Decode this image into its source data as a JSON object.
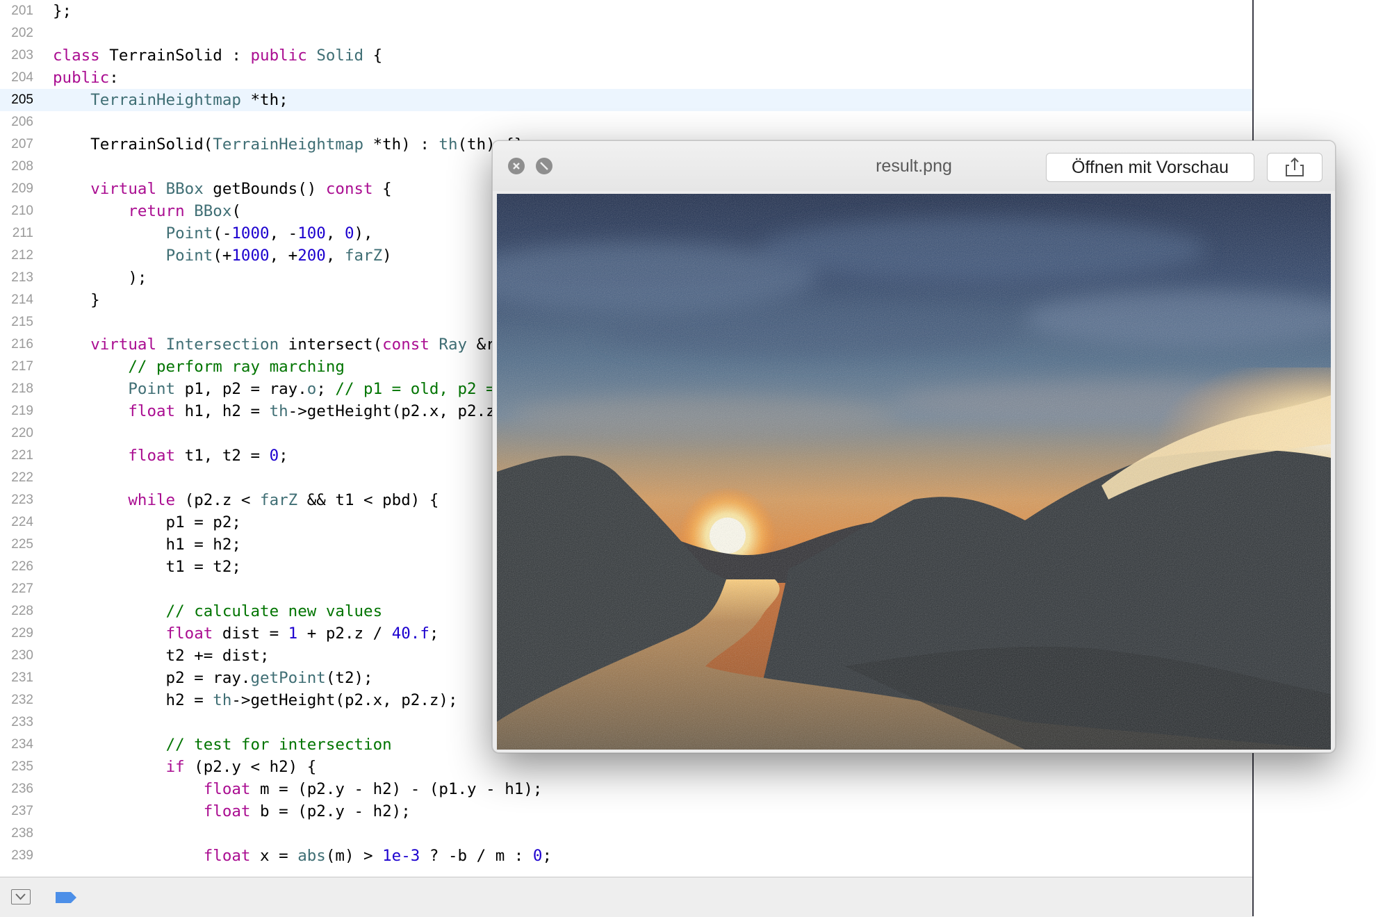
{
  "editor": {
    "current_line": 205,
    "lines": [
      {
        "no": "201",
        "segs": [
          {
            "c": "pl",
            "t": "};"
          }
        ]
      },
      {
        "no": "202",
        "segs": []
      },
      {
        "no": "203",
        "segs": [
          {
            "c": "kw",
            "t": "class"
          },
          {
            "c": "pl",
            "t": " TerrainSolid : "
          },
          {
            "c": "kw",
            "t": "public"
          },
          {
            "c": "pl",
            "t": " "
          },
          {
            "c": "typ",
            "t": "Solid"
          },
          {
            "c": "pl",
            "t": " {"
          }
        ]
      },
      {
        "no": "204",
        "segs": [
          {
            "c": "kw",
            "t": "public"
          },
          {
            "c": "pl",
            "t": ":"
          }
        ]
      },
      {
        "no": "205",
        "segs": [
          {
            "c": "pl",
            "t": "    "
          },
          {
            "c": "typ",
            "t": "TerrainHeightmap"
          },
          {
            "c": "pl",
            "t": " *th;"
          }
        ]
      },
      {
        "no": "206",
        "segs": []
      },
      {
        "no": "207",
        "segs": [
          {
            "c": "pl",
            "t": "    TerrainSolid("
          },
          {
            "c": "typ",
            "t": "TerrainHeightmap"
          },
          {
            "c": "pl",
            "t": " *th) : "
          },
          {
            "c": "typ",
            "t": "th"
          },
          {
            "c": "pl",
            "t": "(th) {}"
          }
        ]
      },
      {
        "no": "208",
        "segs": []
      },
      {
        "no": "209",
        "segs": [
          {
            "c": "pl",
            "t": "    "
          },
          {
            "c": "kw",
            "t": "virtual"
          },
          {
            "c": "pl",
            "t": " "
          },
          {
            "c": "typ",
            "t": "BBox"
          },
          {
            "c": "pl",
            "t": " getBounds() "
          },
          {
            "c": "kw",
            "t": "const"
          },
          {
            "c": "pl",
            "t": " {"
          }
        ]
      },
      {
        "no": "210",
        "segs": [
          {
            "c": "pl",
            "t": "        "
          },
          {
            "c": "kw",
            "t": "return"
          },
          {
            "c": "pl",
            "t": " "
          },
          {
            "c": "typ",
            "t": "BBox"
          },
          {
            "c": "pl",
            "t": "("
          }
        ]
      },
      {
        "no": "211",
        "segs": [
          {
            "c": "pl",
            "t": "            "
          },
          {
            "c": "typ",
            "t": "Point"
          },
          {
            "c": "pl",
            "t": "(-"
          },
          {
            "c": "num",
            "t": "1000"
          },
          {
            "c": "pl",
            "t": ", -"
          },
          {
            "c": "num",
            "t": "100"
          },
          {
            "c": "pl",
            "t": ", "
          },
          {
            "c": "num",
            "t": "0"
          },
          {
            "c": "pl",
            "t": "),"
          }
        ]
      },
      {
        "no": "212",
        "segs": [
          {
            "c": "pl",
            "t": "            "
          },
          {
            "c": "typ",
            "t": "Point"
          },
          {
            "c": "pl",
            "t": "(+"
          },
          {
            "c": "num",
            "t": "1000"
          },
          {
            "c": "pl",
            "t": ", +"
          },
          {
            "c": "num",
            "t": "200"
          },
          {
            "c": "pl",
            "t": ", "
          },
          {
            "c": "typ",
            "t": "farZ"
          },
          {
            "c": "pl",
            "t": ")"
          }
        ]
      },
      {
        "no": "213",
        "segs": [
          {
            "c": "pl",
            "t": "        );"
          }
        ]
      },
      {
        "no": "214",
        "segs": [
          {
            "c": "pl",
            "t": "    }"
          }
        ]
      },
      {
        "no": "215",
        "segs": []
      },
      {
        "no": "216",
        "segs": [
          {
            "c": "pl",
            "t": "    "
          },
          {
            "c": "kw",
            "t": "virtual"
          },
          {
            "c": "pl",
            "t": " "
          },
          {
            "c": "typ",
            "t": "Intersection"
          },
          {
            "c": "pl",
            "t": " intersect("
          },
          {
            "c": "kw",
            "t": "const"
          },
          {
            "c": "pl",
            "t": " "
          },
          {
            "c": "typ",
            "t": "Ray"
          },
          {
            "c": "pl",
            "t": " &r"
          }
        ]
      },
      {
        "no": "217",
        "segs": [
          {
            "c": "pl",
            "t": "        "
          },
          {
            "c": "cmt",
            "t": "// perform ray marching"
          }
        ]
      },
      {
        "no": "218",
        "segs": [
          {
            "c": "pl",
            "t": "        "
          },
          {
            "c": "typ",
            "t": "Point"
          },
          {
            "c": "pl",
            "t": " p1, p2 = ray."
          },
          {
            "c": "typ",
            "t": "o"
          },
          {
            "c": "pl",
            "t": "; "
          },
          {
            "c": "cmt",
            "t": "// p1 = old, p2 ="
          }
        ]
      },
      {
        "no": "219",
        "segs": [
          {
            "c": "pl",
            "t": "        "
          },
          {
            "c": "kw",
            "t": "float"
          },
          {
            "c": "pl",
            "t": " h1, h2 = "
          },
          {
            "c": "typ",
            "t": "th"
          },
          {
            "c": "pl",
            "t": "->getHeight(p2.x, p2.z"
          }
        ]
      },
      {
        "no": "220",
        "segs": []
      },
      {
        "no": "221",
        "segs": [
          {
            "c": "pl",
            "t": "        "
          },
          {
            "c": "kw",
            "t": "float"
          },
          {
            "c": "pl",
            "t": " t1, t2 = "
          },
          {
            "c": "num",
            "t": "0"
          },
          {
            "c": "pl",
            "t": ";"
          }
        ]
      },
      {
        "no": "222",
        "segs": []
      },
      {
        "no": "223",
        "segs": [
          {
            "c": "pl",
            "t": "        "
          },
          {
            "c": "kw",
            "t": "while"
          },
          {
            "c": "pl",
            "t": " (p2.z < "
          },
          {
            "c": "typ",
            "t": "farZ"
          },
          {
            "c": "pl",
            "t": " && t1 < pbd) {"
          }
        ]
      },
      {
        "no": "224",
        "segs": [
          {
            "c": "pl",
            "t": "            p1 = p2;"
          }
        ]
      },
      {
        "no": "225",
        "segs": [
          {
            "c": "pl",
            "t": "            h1 = h2;"
          }
        ]
      },
      {
        "no": "226",
        "segs": [
          {
            "c": "pl",
            "t": "            t1 = t2;"
          }
        ]
      },
      {
        "no": "227",
        "segs": []
      },
      {
        "no": "228",
        "segs": [
          {
            "c": "pl",
            "t": "            "
          },
          {
            "c": "cmt",
            "t": "// calculate new values"
          }
        ]
      },
      {
        "no": "229",
        "segs": [
          {
            "c": "pl",
            "t": "            "
          },
          {
            "c": "kw",
            "t": "float"
          },
          {
            "c": "pl",
            "t": " dist = "
          },
          {
            "c": "num",
            "t": "1"
          },
          {
            "c": "pl",
            "t": " + p2.z / "
          },
          {
            "c": "num",
            "t": "40.f"
          },
          {
            "c": "pl",
            "t": ";"
          }
        ]
      },
      {
        "no": "230",
        "segs": [
          {
            "c": "pl",
            "t": "            t2 += dist;"
          }
        ]
      },
      {
        "no": "231",
        "segs": [
          {
            "c": "pl",
            "t": "            p2 = ray."
          },
          {
            "c": "typ",
            "t": "getPoint"
          },
          {
            "c": "pl",
            "t": "(t2);"
          }
        ]
      },
      {
        "no": "232",
        "segs": [
          {
            "c": "pl",
            "t": "            h2 = "
          },
          {
            "c": "typ",
            "t": "th"
          },
          {
            "c": "pl",
            "t": "->getHeight(p2.x, p2.z);"
          }
        ]
      },
      {
        "no": "233",
        "segs": []
      },
      {
        "no": "234",
        "segs": [
          {
            "c": "pl",
            "t": "            "
          },
          {
            "c": "cmt",
            "t": "// test for intersection"
          }
        ]
      },
      {
        "no": "235",
        "segs": [
          {
            "c": "pl",
            "t": "            "
          },
          {
            "c": "kw",
            "t": "if"
          },
          {
            "c": "pl",
            "t": " (p2.y < h2) {"
          }
        ]
      },
      {
        "no": "236",
        "segs": [
          {
            "c": "pl",
            "t": "                "
          },
          {
            "c": "kw",
            "t": "float"
          },
          {
            "c": "pl",
            "t": " m = (p2.y - h2) - (p1.y - h1);"
          }
        ]
      },
      {
        "no": "237",
        "segs": [
          {
            "c": "pl",
            "t": "                "
          },
          {
            "c": "kw",
            "t": "float"
          },
          {
            "c": "pl",
            "t": " b = (p2.y - h2);"
          }
        ]
      },
      {
        "no": "238",
        "segs": []
      },
      {
        "no": "239",
        "segs": [
          {
            "c": "pl",
            "t": "                "
          },
          {
            "c": "kw",
            "t": "float"
          },
          {
            "c": "pl",
            "t": " x = "
          },
          {
            "c": "typ",
            "t": "abs"
          },
          {
            "c": "pl",
            "t": "(m) > "
          },
          {
            "c": "num",
            "t": "1e-3"
          },
          {
            "c": "pl",
            "t": " ? -b / m : "
          },
          {
            "c": "num",
            "t": "0"
          },
          {
            "c": "pl",
            "t": ";"
          }
        ]
      }
    ]
  },
  "quicklook": {
    "title": "result.png",
    "open_button_label": "Öffnen mit Vorschau",
    "close_icon": "close-icon",
    "fullscreen_icon": "fullscreen-icon",
    "share_icon": "share-icon",
    "image": "rendered sunset terrain with river"
  },
  "debug_bar": {
    "toggle_icon": "hide-debug-area-icon",
    "breakpoint_icon": "breakpoint-icon"
  },
  "colors": {
    "keyword": "#aa0d91",
    "type": "#3f6e74",
    "number": "#1c00cf",
    "comment": "#007400",
    "current_line_bg": "#ecf5fe"
  }
}
